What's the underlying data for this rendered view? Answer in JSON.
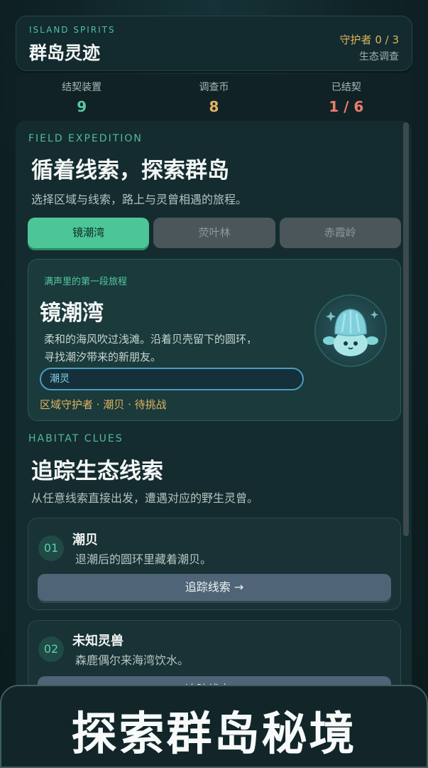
{
  "header": {
    "eyebrow": "ISLAND SPIRITS",
    "title": "群岛灵迹",
    "guardians": "守护者 0 / 3",
    "survey": "生态调查"
  },
  "stats": [
    {
      "label": "结契装置",
      "value": "9",
      "color": "#58c9a3"
    },
    {
      "label": "调查币",
      "value": "8",
      "color": "#e0b45e"
    },
    {
      "label": "已结契",
      "value": "1 / 6",
      "color": "#ec7d6b"
    }
  ],
  "expedition": {
    "eyebrow": "FIELD EXPEDITION",
    "title": "循着线索，探索群岛",
    "subtitle": "选择区域与线索，路上与灵曾相遇的旅程。"
  },
  "tabs": [
    {
      "label": "镜潮湾",
      "active": true
    },
    {
      "label": "荧叶林",
      "active": false
    },
    {
      "label": "赤霞岭",
      "active": false
    }
  ],
  "region": {
    "tag": "满声里的第一段旅程",
    "name": "镜潮湾",
    "desc_line1": "柔和的海风吹过浅滩。沿着贝壳留下的圆环，",
    "desc_line2": "寻找潮汐带来的新朋友。",
    "chip": "潮灵",
    "meta": "区域守护者 · 潮贝 · 待挑战"
  },
  "clues_section": {
    "eyebrow": "HABITAT CLUES",
    "title": "追踪生态线索",
    "subtitle": "从任意线索直接出发，遭遇对应的野生灵曾。"
  },
  "clues": [
    {
      "num": "01",
      "name": "潮贝",
      "desc": "退潮后的圆环里藏着潮贝。",
      "button": "追踪线索 →"
    },
    {
      "num": "02",
      "name": "未知灵兽",
      "desc": "森鹿偶尔来海湾饮水。",
      "button": "追踪线索 →"
    }
  ],
  "banner": {
    "text": "探索群岛秘境"
  }
}
